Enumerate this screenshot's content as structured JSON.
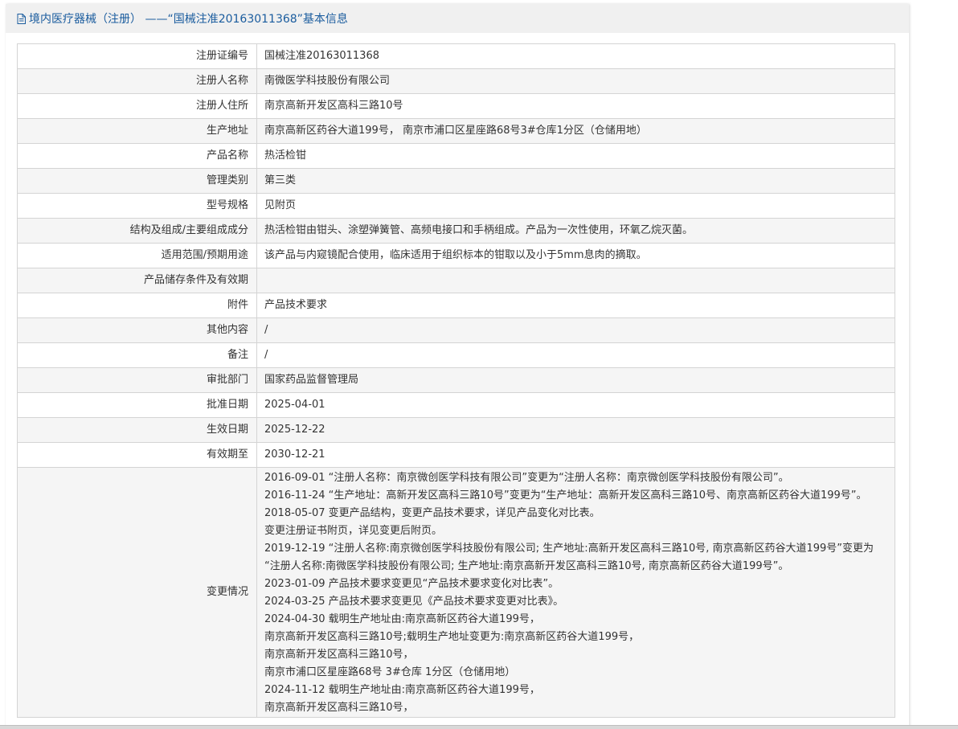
{
  "header": {
    "title": "境内医疗器械（注册） ——“国械注准20163011368”基本信息"
  },
  "rows": [
    {
      "label": "注册证编号",
      "value": "国械注准20163011368"
    },
    {
      "label": "注册人名称",
      "value": "南微医学科技股份有限公司"
    },
    {
      "label": "注册人住所",
      "value": "南京高新开发区高科三路10号"
    },
    {
      "label": "生产地址",
      "value": "南京高新区药谷大道199号， 南京市浦口区星座路68号3#仓库1分区（仓储用地）"
    },
    {
      "label": "产品名称",
      "value": "热活检钳"
    },
    {
      "label": "管理类别",
      "value": "第三类"
    },
    {
      "label": "型号规格",
      "value": "见附页"
    },
    {
      "label": "结构及组成/主要组成成分",
      "value": "热活检钳由钳头、涂塑弹簧管、高频电接口和手柄组成。产品为一次性使用，环氧乙烷灭菌。"
    },
    {
      "label": "适用范围/预期用途",
      "value": "该产品与内窥镜配合使用，临床适用于组织标本的钳取以及小于5mm息肉的摘取。"
    },
    {
      "label": "产品储存条件及有效期",
      "value": ""
    },
    {
      "label": "附件",
      "value": "产品技术要求"
    },
    {
      "label": "其他内容",
      "value": "/"
    },
    {
      "label": "备注",
      "value": "/"
    },
    {
      "label": "审批部门",
      "value": "国家药品监督管理局"
    },
    {
      "label": "批准日期",
      "value": "2025-04-01"
    },
    {
      "label": "生效日期",
      "value": "2025-12-22"
    },
    {
      "label": "有效期至",
      "value": "2030-12-21"
    }
  ],
  "changes": {
    "label": "变更情况",
    "lines": [
      "2016-09-01 “注册人名称：南京微创医学科技有限公司”变更为“注册人名称：南京微创医学科技股份有限公司”。",
      "2016-11-24 “生产地址：高新开发区高科三路10号”变更为“生产地址：高新开发区高科三路10号、南京高新区药谷大道199号”。",
      "2018-05-07 变更产品结构，变更产品技术要求，详见产品变化对比表。",
      "变更注册证书附页，详见变更后附页。",
      "2019-12-19 “注册人名称:南京微创医学科技股份有限公司; 生产地址:高新开发区高科三路10号, 南京高新区药谷大道199号”变更为",
      "“注册人名称:南微医学科技股份有限公司; 生产地址:南京高新开发区高科三路10号, 南京高新区药谷大道199号”。",
      "2023-01-09 产品技术要求变更见“产品技术要求变化对比表”。",
      "2024-03-25 产品技术要求变更见《产品技术要求变更对比表》。",
      "2024-04-30 载明生产地址由:南京高新区药谷大道199号，",
      "南京高新开发区高科三路10号;载明生产地址变更为:南京高新区药谷大道199号，",
      "南京高新开发区高科三路10号，",
      "南京市浦口区星座路68号 3#仓库 1分区（仓储用地）",
      "2024-11-12 载明生产地址由:南京高新区药谷大道199号，",
      "南京高新开发区高科三路10号，"
    ]
  },
  "colors": {
    "header_text": "#1a5c9e",
    "border": "#d4d4d4",
    "alt_row": "#f5f5f5"
  },
  "icons": {
    "header": "document-icon"
  }
}
